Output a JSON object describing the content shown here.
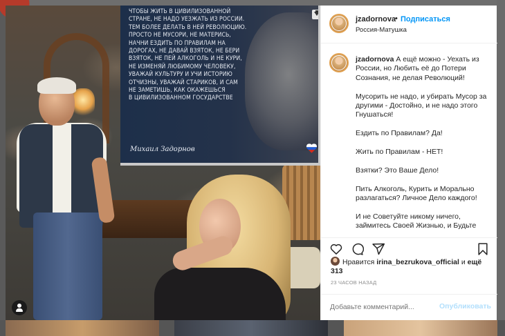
{
  "quote_card": {
    "lines": [
      "Чтобы жить в цивилизованной",
      "стране, не надо уезжать из России.",
      "Тем более делать в ней революцию.",
      "Просто не мусори, не матерись,",
      "начни ездить по правилам на",
      "дорогах, не давай взяток, не бери",
      "взяток, не пей алкоголь и не кури,",
      "не изменяй любимому человеку,",
      "уважай культуру и учи историю",
      "отчизны, уважай стариков, и сам",
      "не заметишь, как окажешься",
      "в цивилизованном государстве"
    ],
    "signature": "Михаил Задорнов"
  },
  "header": {
    "username": "jzadornova",
    "dot": "•",
    "follow_label": "Подписаться",
    "location": "Россия-Матушка"
  },
  "caption": {
    "username": "jzadornova",
    "first": "А ещё можно - Уехать из России, но Любить её до Потери Сознания, не делая Революций!",
    "paragraphs": [
      "Мусорить не надо, и убирать Мусор за другими - Достойно, и не надо этого Гнушаться!",
      "Ездить по Правилам? Да!",
      "Жить по Правилам - НЕТ!",
      "Взятки? Это Ваше Дело!",
      "Пить Алкоголь, Курить и Морально разлагаться? Личное Дело каждого!",
      "И не Советуйте никому ничего, займитесь Своей Жизнью, и Будьте"
    ]
  },
  "likes": {
    "prefix": "Нравится",
    "user": "irina_bezrukova_official",
    "middle": "и",
    "suffix": "ещё 313"
  },
  "timestamp": "23 ЧАСОВ НАЗАД",
  "comment": {
    "placeholder": "Добавьте комментарий...",
    "publish_label": "Опубликовать"
  },
  "icons": [
    "heart-icon",
    "comment-icon",
    "share-icon",
    "bookmark-icon",
    "download-icon",
    "user-tag-icon"
  ],
  "colors": {
    "accent": "#0095f6",
    "publish_disabled": "#b2dffc",
    "text": "#262626",
    "muted": "#8e8e8e"
  }
}
